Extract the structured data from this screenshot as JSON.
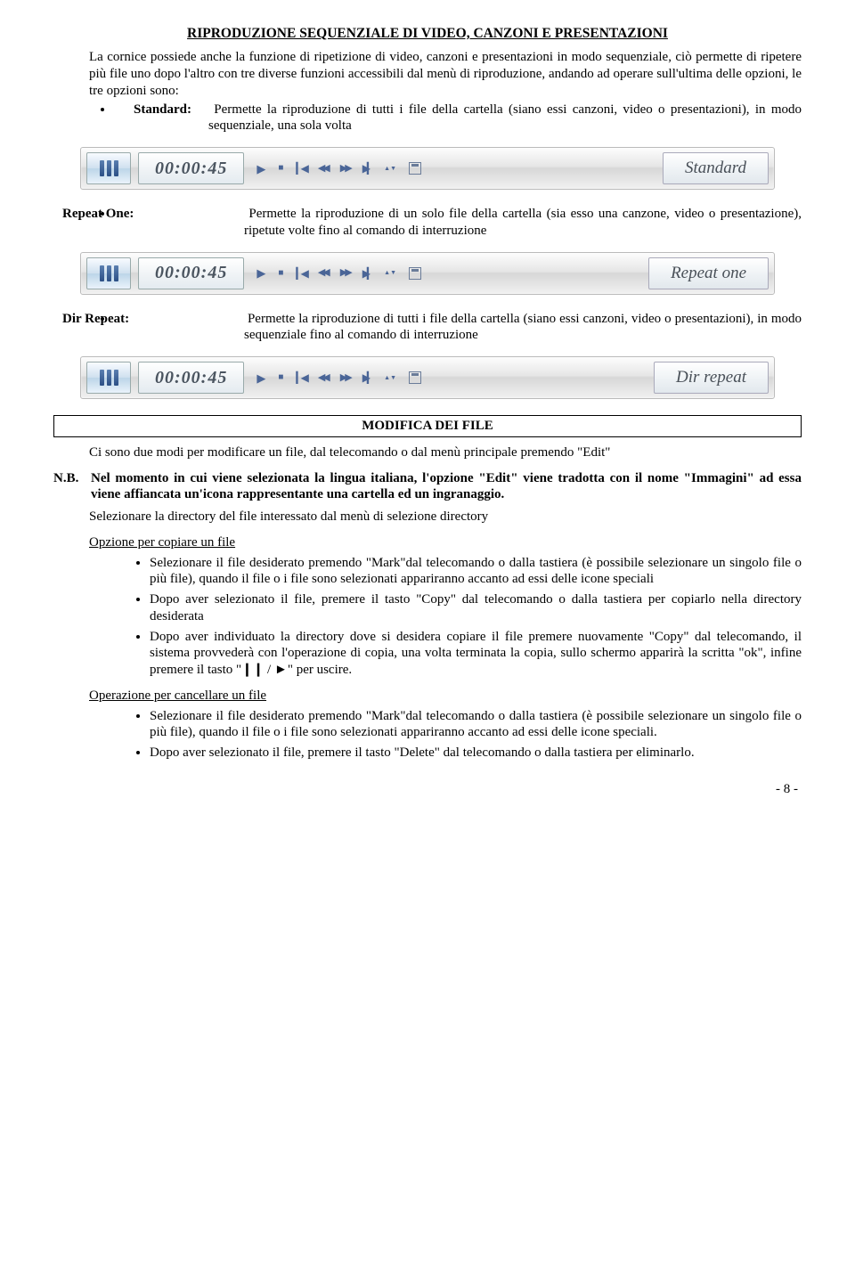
{
  "section1": {
    "title": "RIPRODUZIONE SEQUENZIALE DI VIDEO, CANZONI E PRESENTAZIONI",
    "intro": "La cornice possiede anche la funzione di ripetizione di video, canzoni e presentazioni in modo sequenziale, ciò permette di ripetere più file uno dopo l'altro con tre diverse funzioni accessibili dal menù di riproduzione, andando ad operare sull'ultima delle opzioni, le tre opzioni sono:",
    "items": [
      {
        "term": "Standard:",
        "desc": "Permette la riproduzione di tutti i file della cartella (siano essi canzoni, video o presentazioni), in modo sequenziale, una sola volta"
      },
      {
        "term": "Repeat One:",
        "desc": "Permette la riproduzione di un solo file della cartella (sia esso una canzone, video o presentazione), ripetute volte fino al comando di interruzione"
      },
      {
        "term": "Dir Repeat:",
        "desc": "Permette la riproduzione di tutti i file della cartella (siano essi canzoni, video o presentazioni), in modo sequenziale fino al comando di interruzione"
      }
    ]
  },
  "player": {
    "time": "00:00:45",
    "modes": [
      "Standard",
      "Repeat one",
      "Dir repeat"
    ]
  },
  "section2": {
    "title": "MODIFICA DEI FILE",
    "p1": "Ci sono due modi per modificare un file, dal telecomando o dal menù principale premendo \"Edit\"",
    "nb_label": "N.B.",
    "nb_text": "Nel momento in cui viene selezionata la lingua italiana, l'opzione \"Edit\" viene tradotta con il nome \"Immagini\" ad essa viene affiancata un'icona  rappresentante una cartella ed un ingranaggio.",
    "p2": "Selezionare la directory del file interessato dal menù di selezione directory",
    "copy_head": "Opzione per copiare un file",
    "copy_items": [
      "Selezionare il file desiderato premendo \"Mark\"dal telecomando o dalla tastiera (è possibile selezionare un singolo file o più file), quando il file o i file sono selezionati appariranno accanto ad essi delle icone speciali",
      "Dopo aver selezionato il file, premere il tasto \"Copy\" dal telecomando o dalla tastiera per copiarlo nella directory desiderata",
      "Dopo aver individuato la directory dove si desidera copiare il file premere nuovamente \"Copy\" dal telecomando, il sistema provvederà con l'operazione di copia, una volta terminata la copia, sullo schermo apparirà la scritta \"ok\", infine premere il tasto \"❙❙ / ►\" per uscire."
    ],
    "del_head": "Operazione per cancellare un file",
    "del_items": [
      "Selezionare il file desiderato premendo \"Mark\"dal telecomando o dalla tastiera (è possibile selezionare un singolo file o più file), quando il file o i file sono selezionati appariranno accanto ad essi delle icone speciali.",
      "Dopo aver selezionato il file, premere il tasto \"Delete\" dal telecomando o dalla tastiera per eliminarlo."
    ]
  },
  "page_number": "- 8 -"
}
